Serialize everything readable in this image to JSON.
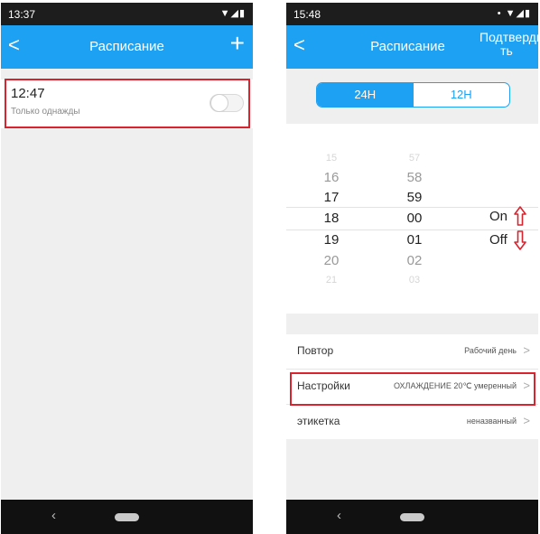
{
  "left": {
    "status": {
      "time": "13:37",
      "icons": "▼◢▮"
    },
    "appbar": {
      "back": "<",
      "title": "Расписание",
      "add": "+"
    },
    "item": {
      "time": "12:47",
      "note": "Только однажды",
      "enabled": false
    },
    "nav": {
      "back": "‹"
    }
  },
  "right": {
    "status": {
      "time": "15:48",
      "icons": "• ▼◢▮"
    },
    "appbar": {
      "back": "<",
      "title": "Расписание",
      "confirm": "Подтверди ть"
    },
    "segment": {
      "h24": "24H",
      "h12": "12H",
      "selected": "24H"
    },
    "picker": {
      "hours": [
        "15",
        "16",
        "17",
        "18",
        "19",
        "20",
        "21"
      ],
      "minutes": [
        "57",
        "58",
        "59",
        "00",
        "01",
        "02",
        "03"
      ],
      "on": "On",
      "off": "Off"
    },
    "rows": [
      {
        "label": "Повтор",
        "value": "Рабочий день"
      },
      {
        "label": "Настройки",
        "value": "ОХЛАЖДЕНИЕ 20℃ умеренный"
      },
      {
        "label": "этикетка",
        "value": "неназванный"
      }
    ],
    "chevron": ">",
    "nav": {
      "back": "‹"
    }
  },
  "colors": {
    "accent": "#1da1f2",
    "highlight": "#d9232e",
    "statusbar": "#1d1d1d"
  }
}
